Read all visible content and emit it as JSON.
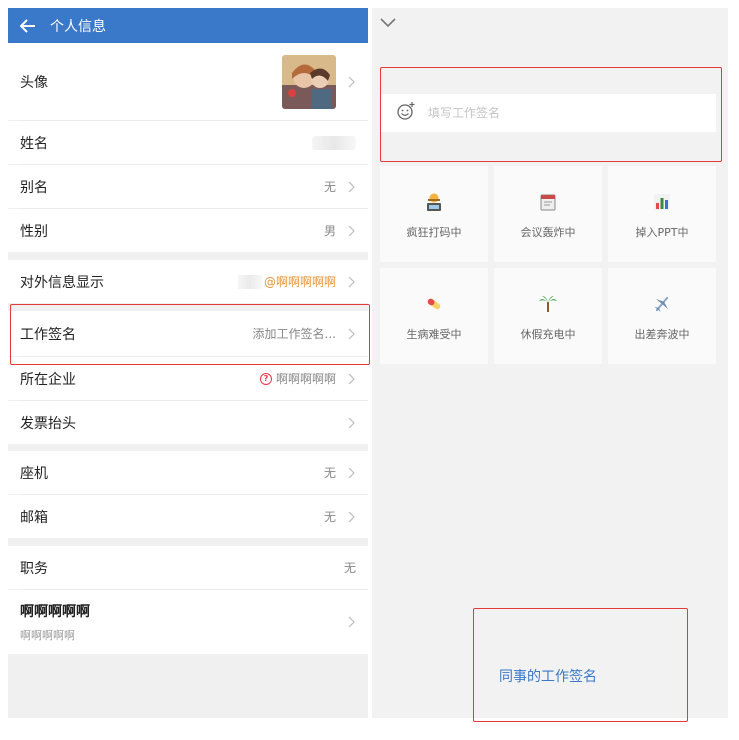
{
  "header": {
    "title": "个人信息"
  },
  "profile": {
    "avatar": {
      "label": "头像"
    },
    "name": {
      "label": "姓名"
    },
    "alias": {
      "label": "别名",
      "value": "无"
    },
    "gender": {
      "label": "性别",
      "value": "男"
    },
    "external": {
      "label": "对外信息显示",
      "value": "@啊啊啊啊啊"
    },
    "signature": {
      "label": "工作签名",
      "value": "添加工作签名..."
    },
    "company": {
      "label": "所在企业",
      "value": "啊啊啊啊啊"
    },
    "invoice": {
      "label": "发票抬头"
    },
    "landline": {
      "label": "座机",
      "value": "无"
    },
    "email": {
      "label": "邮箱",
      "value": "无"
    },
    "position": {
      "label": "职务",
      "value": "无"
    },
    "custom": {
      "label": "啊啊啊啊啊",
      "sub": "啊啊啊啊啊"
    }
  },
  "signature_editor": {
    "placeholder": "填写工作签名",
    "presets": [
      {
        "label": "疯狂打码中",
        "icon": "coder-emoji-icon"
      },
      {
        "label": "会议轰炸中",
        "icon": "calendar-emoji-icon"
      },
      {
        "label": "掉入PPT中",
        "icon": "bar-chart-emoji-icon"
      },
      {
        "label": "生病难受中",
        "icon": "pill-emoji-icon"
      },
      {
        "label": "休假充电中",
        "icon": "palm-tree-emoji-icon"
      },
      {
        "label": "出差奔波中",
        "icon": "airplane-emoji-icon"
      }
    ],
    "colleague_link": "同事的工作签名"
  },
  "colors": {
    "header": "#3a78c9",
    "highlight": "#e53a3a",
    "accent_orange": "#e8963a",
    "link": "#3a78c9"
  }
}
